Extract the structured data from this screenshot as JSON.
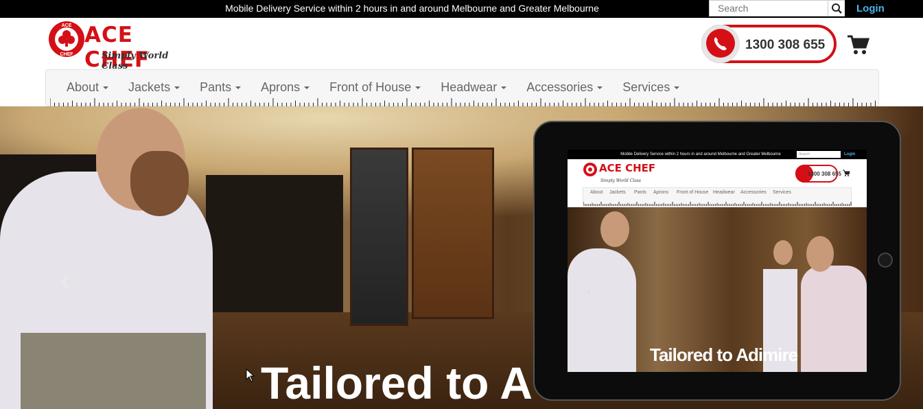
{
  "topbar": {
    "promo": "Mobile Delivery Service within 2 hours in and around Melbourne and Greater Melbourne",
    "search_placeholder": "Search",
    "search_icon": "search-icon",
    "login_label": "Login"
  },
  "header": {
    "logo_brand": "ACE CHEF",
    "logo_badge_top": "ACE",
    "logo_badge_bottom": "CHEF",
    "logo_tagline": "Simply World Class",
    "phone_number": "1300 308 655",
    "phone_icon": "phone-icon",
    "cart_icon": "cart-icon"
  },
  "nav": {
    "items": [
      {
        "label": "About"
      },
      {
        "label": "Jackets"
      },
      {
        "label": "Pants"
      },
      {
        "label": "Aprons"
      },
      {
        "label": "Front of House"
      },
      {
        "label": "Headwear"
      },
      {
        "label": "Accessories"
      },
      {
        "label": "Services"
      }
    ]
  },
  "hero": {
    "title": "Tailored to A",
    "prev_arrow": "‹"
  },
  "tablet": {
    "promo": "Mobile Delivery Service within 2 hours in and around Melbourne and Greater Melbourne",
    "search": "Search",
    "login": "Login",
    "logo": "ACE CHEF",
    "tagline": "Simply World Class",
    "phone": "1300 308 655",
    "nav": [
      "About",
      "Jackets",
      "Pants",
      "Aprons",
      "Front of House",
      "Headwear",
      "Accessories",
      "Services"
    ],
    "title": "Tailored to Adimire",
    "prev_arrow": "‹",
    "next_arrow": "›"
  },
  "colors": {
    "brand_red": "#d41016",
    "login_blue": "#49b6e8",
    "topbar_bg": "#000000",
    "nav_text": "#666666"
  }
}
